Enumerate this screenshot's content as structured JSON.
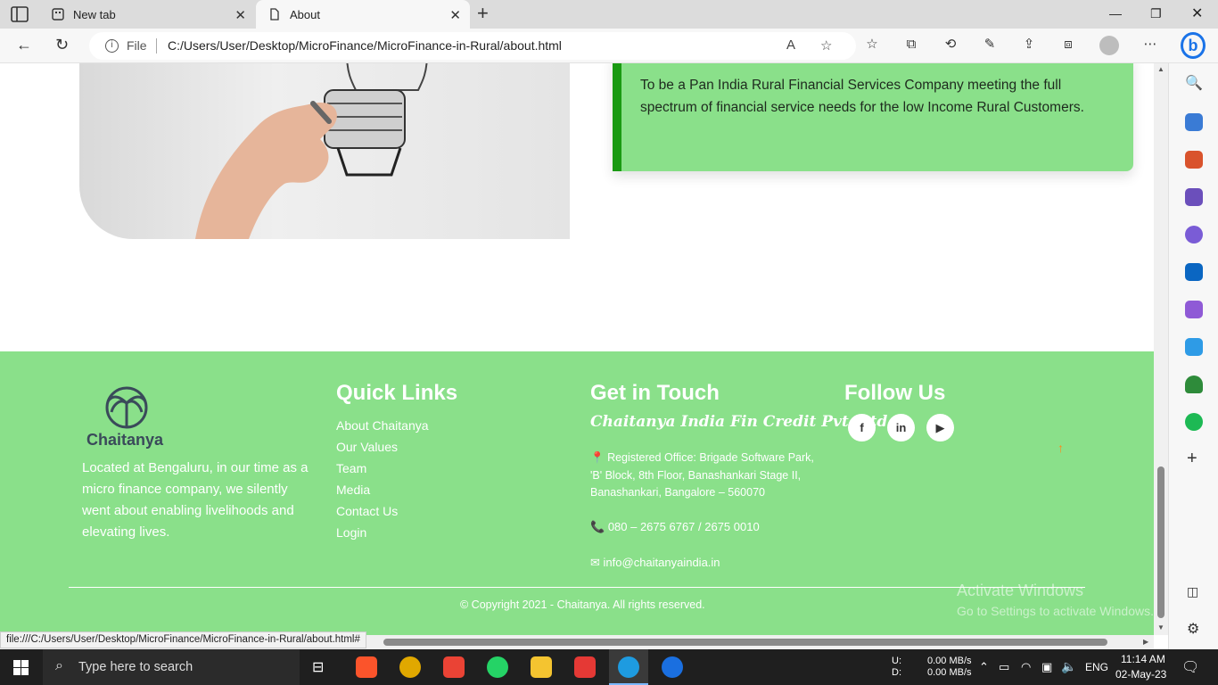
{
  "browser": {
    "tabs": [
      {
        "label": "New tab"
      },
      {
        "label": "About"
      }
    ],
    "address": {
      "scheme_label": "File",
      "url": "C:/Users/User/Desktop/MicroFinance/MicroFinance-in-Rural/about.html"
    },
    "status_url": "file:///C:/Users/User/Desktop/MicroFinance/MicroFinance-in-Rural/about.html#"
  },
  "vision": {
    "text": "To be a Pan India Rural Financial Services Company meeting the full spectrum of financial service needs for the low Income Rural Customers."
  },
  "footer": {
    "brand": "Chaitanya",
    "about": "Located at Bengaluru, in our time as a micro finance company, we silently went about enabling livelihoods and elevating lives.",
    "quick_links": {
      "heading": "Quick Links",
      "items": [
        "About Chaitanya",
        "Our Values",
        "Team",
        "Media",
        "Contact Us",
        "Login"
      ]
    },
    "contact": {
      "heading": "Get in Touch",
      "company": "Chaitanya India Fin Credit Pvt. Ltd.",
      "address": "Registered Office: Brigade Software Park, 'B' Block, 8th Floor, Banashankari Stage II, Banashankari, Bangalore – 560070",
      "phone": "080 – 2675 6767 / 2675 0010",
      "email": "info@chaitanyaindia.in"
    },
    "follow": {
      "heading": "Follow Us"
    },
    "copyright": "© Copyright 2021 - Chaitanya. All rights reserved.",
    "watermark_title": "Activate Windows",
    "watermark_sub": "Go to Settings to activate Windows."
  },
  "taskbar": {
    "search_placeholder": "Type here to search",
    "net_up_label": "U:",
    "net_down_label": "D:",
    "net_up": "0.00 MB/s",
    "net_down": "0.00 MB/s",
    "lang": "ENG",
    "time": "11:14 AM",
    "date": "02-May-23"
  },
  "colors": {
    "footer_bg": "#8ae08a",
    "accent_green": "#1a9a12",
    "scroll_top": "#ff8a1a"
  }
}
